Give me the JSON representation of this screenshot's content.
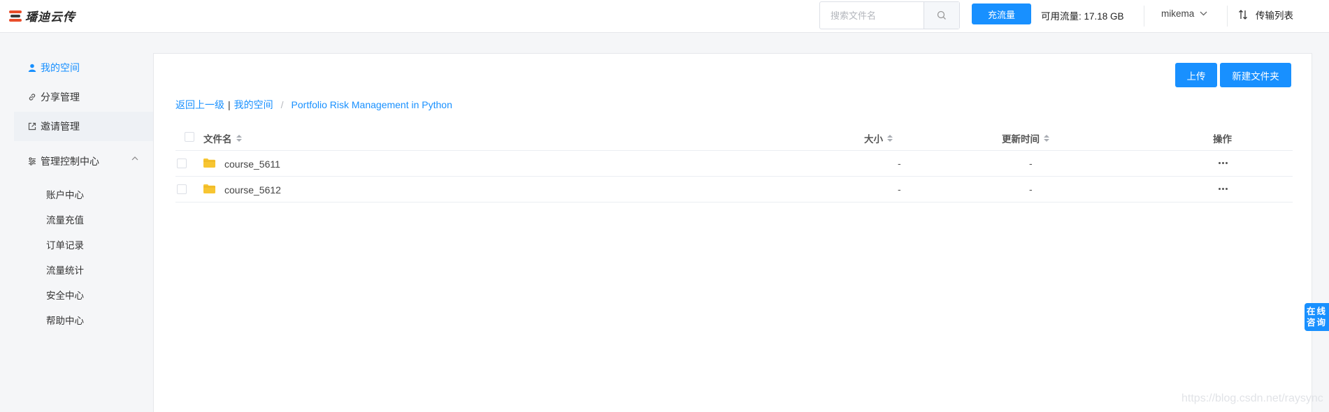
{
  "header": {
    "logo_text": "璠迪云传",
    "search_placeholder": "搜索文件名",
    "search_icon": "search-icon",
    "recharge_label": "充流量",
    "traffic_label": "可用流量: 17.18 GB",
    "username": "mikema",
    "transfer_label": "传输列表"
  },
  "sidebar": {
    "items": [
      {
        "label": "我的空间",
        "icon": "user-icon"
      },
      {
        "label": "分享管理",
        "icon": "link-icon"
      },
      {
        "label": "邀请管理",
        "icon": "external-link-icon"
      }
    ],
    "group": {
      "label": "管理控制中心",
      "icon": "sliders-icon"
    },
    "sub_items": [
      "账户中心",
      "流量充值",
      "订单记录",
      "流量统计",
      "安全中心",
      "帮助中心"
    ]
  },
  "main": {
    "upload_label": "上传",
    "new_folder_label": "新建文件夹",
    "breadcrumb": {
      "back": "返回上一级",
      "separator": "|",
      "root": "我的空间",
      "slash": "/",
      "current": "Portfolio Risk Management in Python"
    },
    "columns": {
      "name": "文件名",
      "size": "大小",
      "updated": "更新时间",
      "actions": "操作"
    },
    "rows": [
      {
        "name": "course_5611",
        "size": "-",
        "updated": "-"
      },
      {
        "name": "course_5612",
        "size": "-",
        "updated": "-"
      }
    ]
  },
  "chat": {
    "label": "在线咨询"
  },
  "watermark": "https://blog.csdn.net/raysync",
  "colors": {
    "accent": "#1890ff",
    "folder": "#f7c531",
    "logo_red": "#e94d2a"
  }
}
